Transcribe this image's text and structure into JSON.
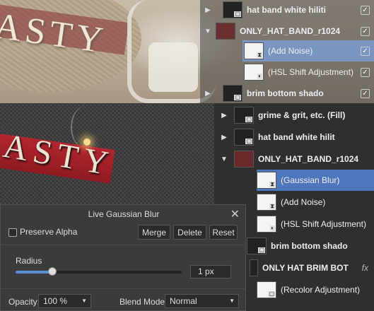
{
  "image_text": {
    "hat_lettering_top": "ASTY",
    "hat_lettering_bottom": "ASTY"
  },
  "layers_top": [
    {
      "label": "hat band white hiliti",
      "bold": true,
      "checked": "✓"
    },
    {
      "label": "ONLY_HAT_BAND_r1024",
      "bold": true,
      "expanded": true,
      "checked": "✓"
    },
    {
      "label": "(Add Noise)",
      "selected": true,
      "checked": "✓"
    },
    {
      "label": "(HSL Shift Adjustment)",
      "checked": "✓"
    },
    {
      "label": "brim bottom shado",
      "bold": true,
      "checked": "✓"
    }
  ],
  "layers_bottom": [
    {
      "label": "grime & grit, etc. (Fill)"
    },
    {
      "label": "hat band white hilit"
    },
    {
      "label": "ONLY_HAT_BAND_r1024"
    },
    {
      "label": "(Gaussian Blur)",
      "selected": true
    },
    {
      "label": "(Add Noise)"
    },
    {
      "label": "(HSL Shift Adjustment)"
    },
    {
      "label": "brim bottom shado"
    },
    {
      "label": "ONLY HAT BRIM BOT"
    },
    {
      "label": "(Recolor Adjustment)"
    }
  ],
  "fx_label": "fx",
  "dialog": {
    "title": "Live Gaussian Blur",
    "close": "✕",
    "preserve_alpha": "Preserve Alpha",
    "merge": "Merge",
    "delete": "Delete",
    "reset": "Reset",
    "radius_label": "Radius",
    "radius_value": "1 px",
    "radius_fraction": 0.22,
    "opacity_label": "Opacity:",
    "opacity_value": "100 %",
    "blend_label": "Blend Mode:",
    "blend_value": "Normal"
  },
  "colors": {
    "selection": "#4e76bd",
    "ribbon": "#b3262f"
  }
}
